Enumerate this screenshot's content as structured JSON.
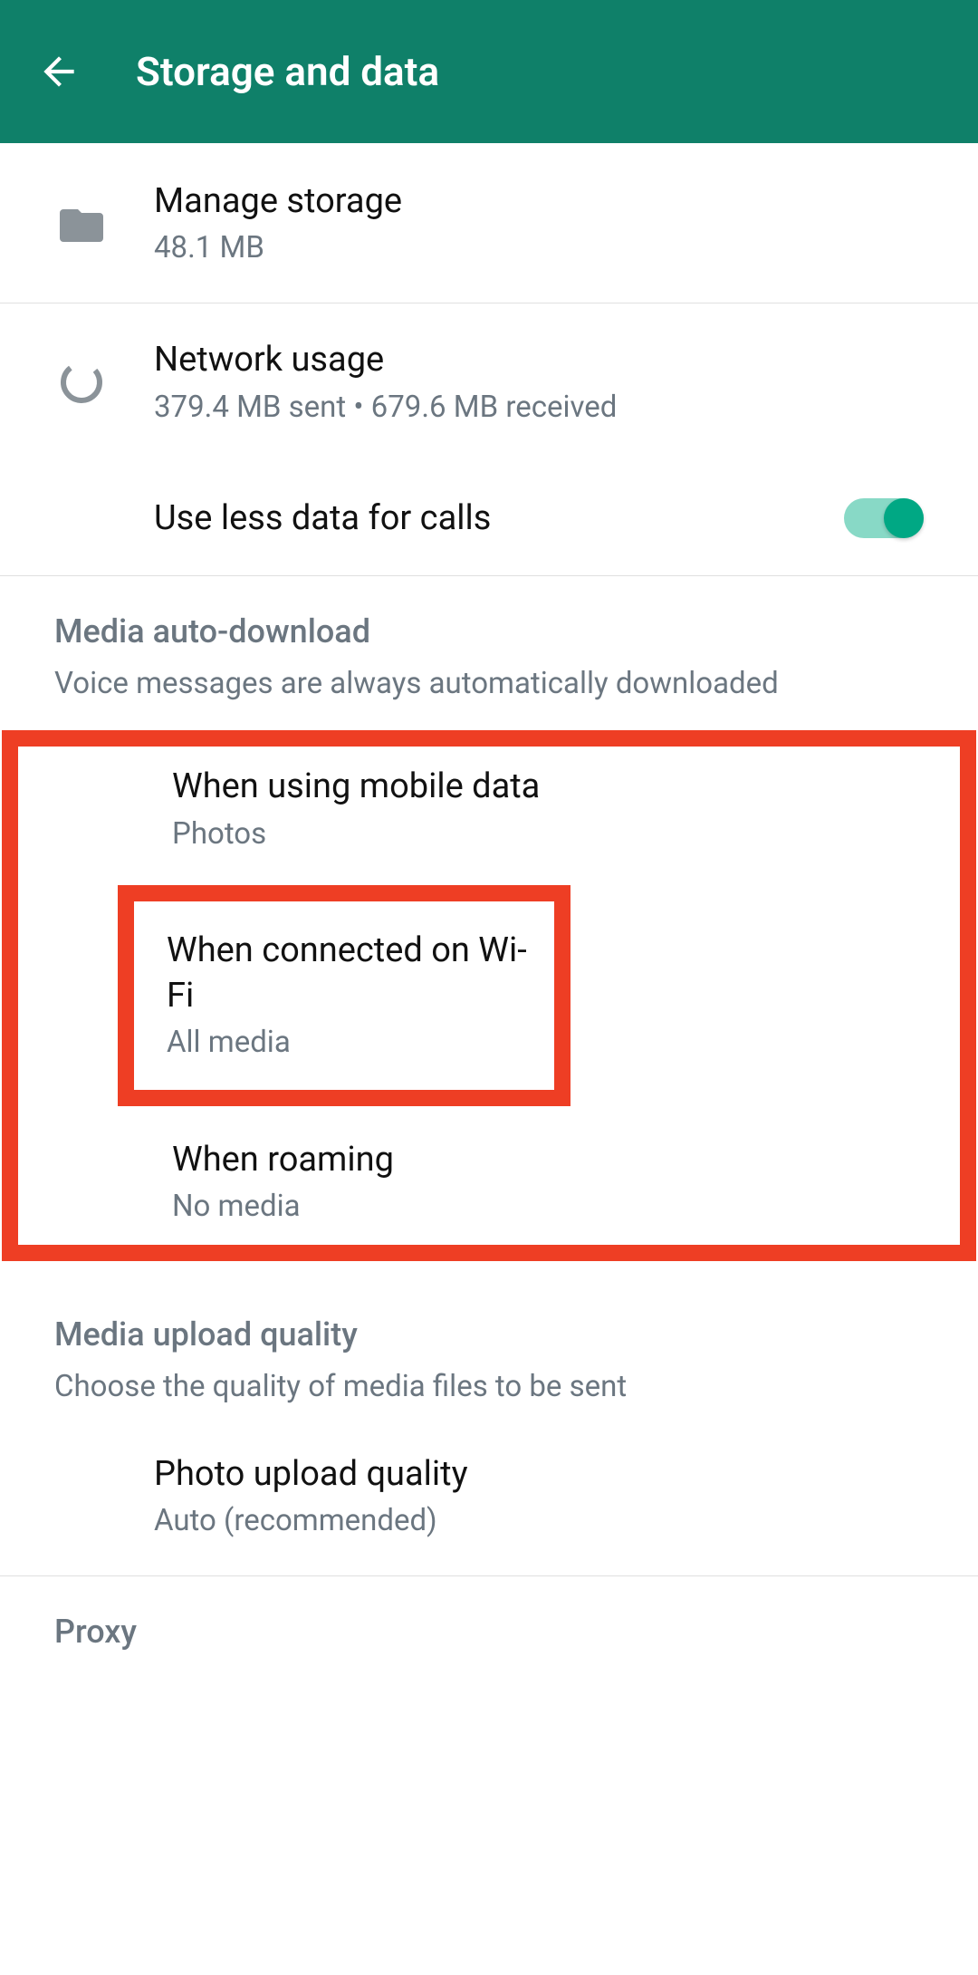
{
  "header": {
    "title": "Storage and data"
  },
  "manage_storage": {
    "title": "Manage storage",
    "subtitle": "48.1 MB"
  },
  "network_usage": {
    "title": "Network usage",
    "subtitle": "379.4 MB sent • 679.6 MB received"
  },
  "use_less_data": {
    "title": "Use less data for calls",
    "enabled": true
  },
  "media_auto_download": {
    "section_title": "Media auto-download",
    "section_subtitle": "Voice messages are always automatically downloaded",
    "mobile_data": {
      "title": "When using mobile data",
      "subtitle": "Photos"
    },
    "wifi": {
      "title": "When connected on Wi-Fi",
      "subtitle": "All media"
    },
    "roaming": {
      "title": "When roaming",
      "subtitle": "No media"
    }
  },
  "media_upload_quality": {
    "section_title": "Media upload quality",
    "section_subtitle": "Choose the quality of media files to be sent",
    "photo": {
      "title": "Photo upload quality",
      "subtitle": "Auto (recommended)"
    }
  },
  "proxy": {
    "section_title": "Proxy"
  }
}
